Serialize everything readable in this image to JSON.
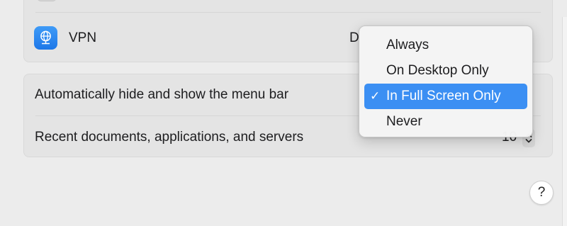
{
  "rows": {
    "vpn": {
      "label": "VPN",
      "value_partial": "D",
      "icon": "globe-network-icon"
    },
    "auto_hide": {
      "label": "Automatically hide and show the menu bar"
    },
    "recents": {
      "label": "Recent documents, applications, and servers",
      "value": "10"
    }
  },
  "popup_menu": {
    "items": [
      {
        "label": "Always",
        "selected": false
      },
      {
        "label": "On Desktop Only",
        "selected": false
      },
      {
        "label": "In Full Screen Only",
        "selected": true
      },
      {
        "label": "Never",
        "selected": false
      }
    ],
    "checkmark": "✓"
  },
  "help_button": {
    "label": "?"
  },
  "colors": {
    "accent": "#3b8ff3",
    "vpn_icon": "#2a87f0",
    "window_background": "#ececec",
    "group_background": "#e4e4e4"
  }
}
